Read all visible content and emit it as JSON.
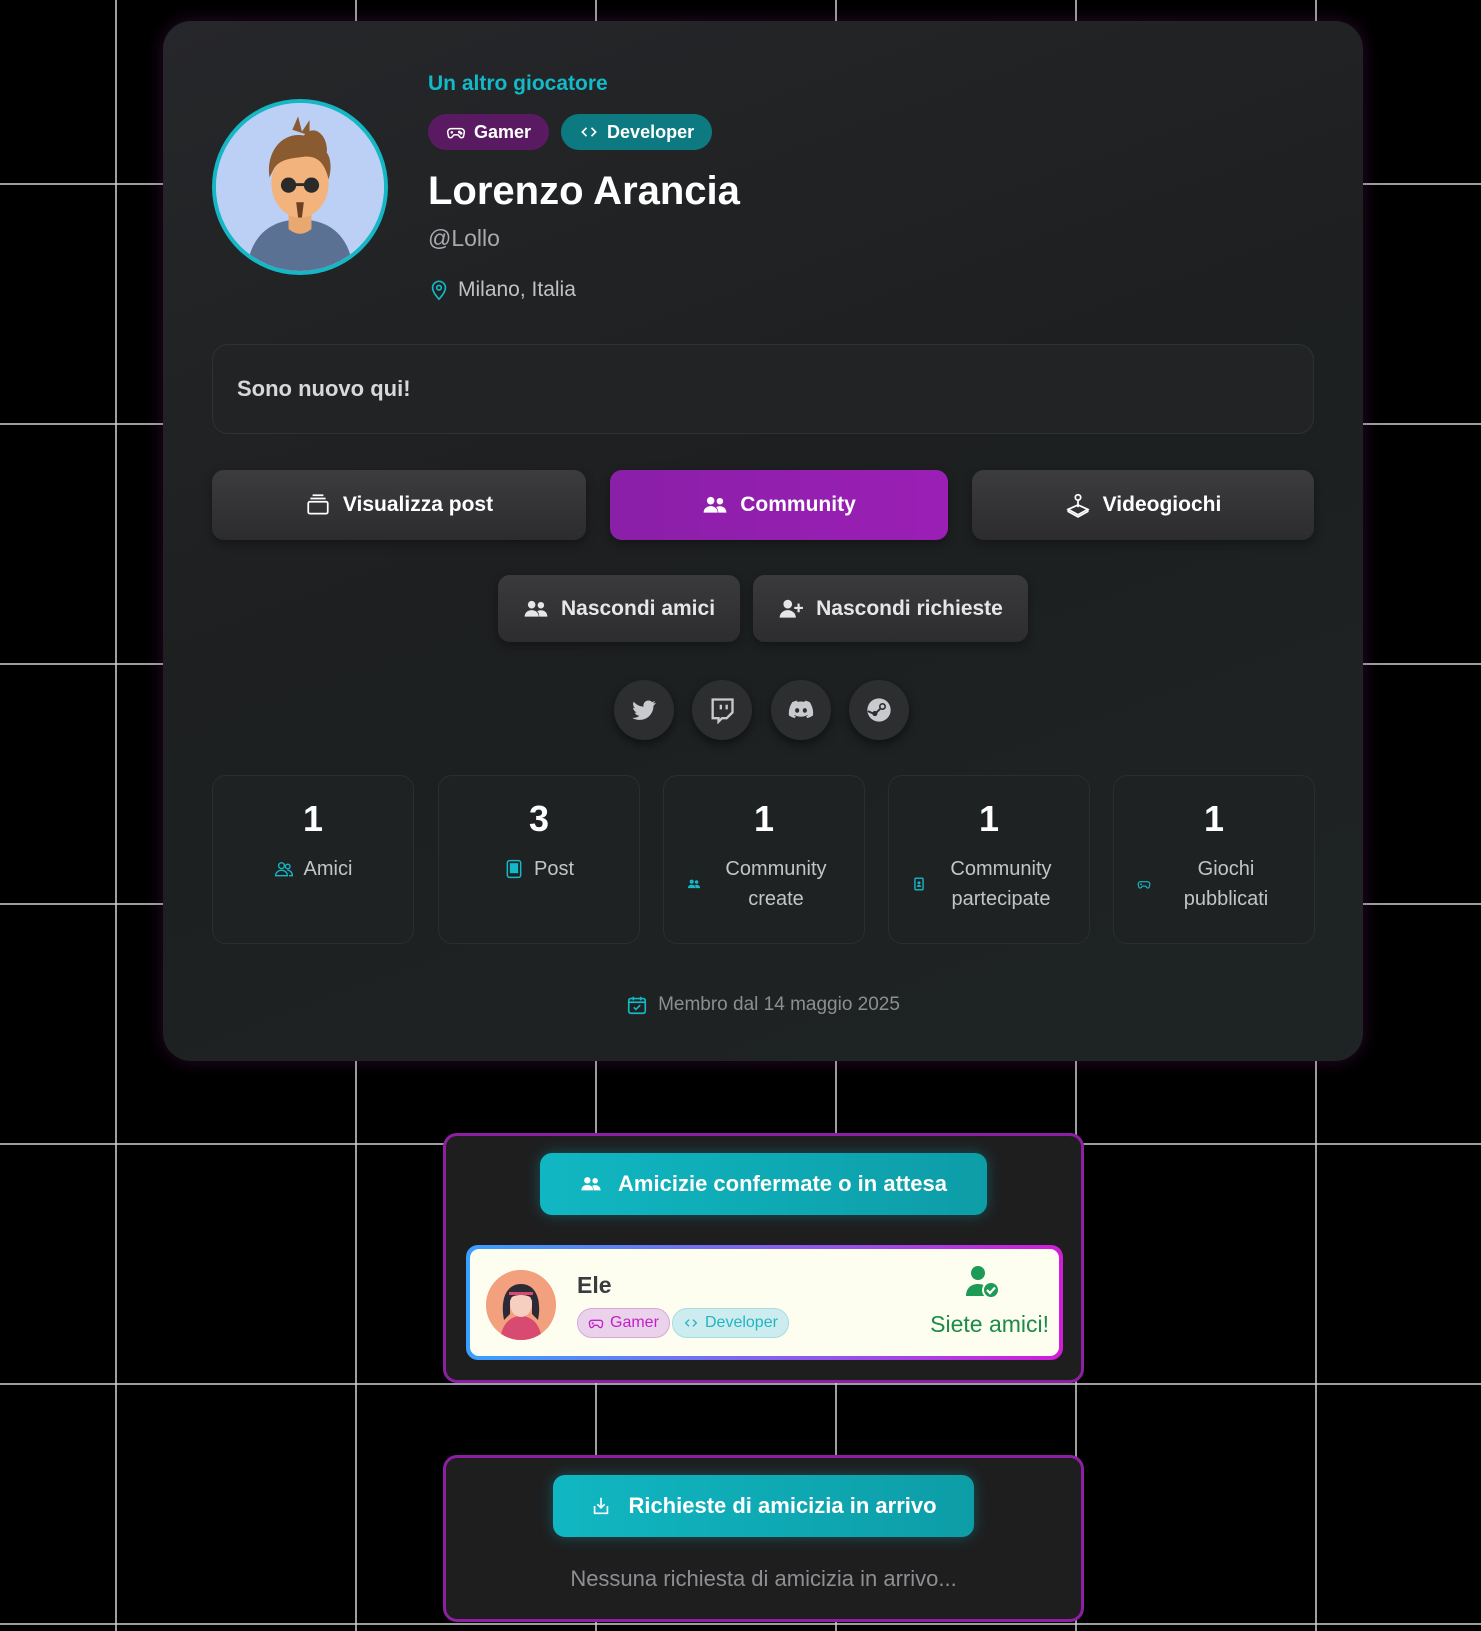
{
  "profile": {
    "subtitle": "Un altro giocatore",
    "badges": [
      {
        "label": "Gamer",
        "icon": "gamepad-icon",
        "color": "#5a1a62"
      },
      {
        "label": "Developer",
        "icon": "code-icon",
        "color": "#0c7a80"
      }
    ],
    "name": "Lorenzo Arancia",
    "handle": "@Lollo",
    "location": "Milano, Italia",
    "bio": "Sono nuovo qui!",
    "accent_color": "#13b9c6",
    "brand_purple": "#8a1fa8"
  },
  "nav": {
    "posts_label": "Visualizza post",
    "community_label": "Community",
    "games_label": "Videogiochi",
    "active": "Community"
  },
  "toggles": {
    "friends_label": "Nascondi amici",
    "requests_label": "Nascondi richieste"
  },
  "social_links": [
    {
      "icon": "twitter-icon"
    },
    {
      "icon": "twitch-icon"
    },
    {
      "icon": "discord-icon"
    },
    {
      "icon": "steam-icon"
    }
  ],
  "stats": [
    {
      "value": "1",
      "label": "Amici",
      "icon": "users-icon"
    },
    {
      "value": "3",
      "label": "Post",
      "icon": "post-icon"
    },
    {
      "value": "1",
      "label": "Community create",
      "icon": "group-icon"
    },
    {
      "value": "1",
      "label": "Community partecipate",
      "icon": "badge-icon"
    },
    {
      "value": "1",
      "label": "Giochi pubblicati",
      "icon": "gamepad-icon"
    }
  ],
  "member_since": "Membro dal 14 maggio 2025",
  "friends_panel": {
    "title": "Amicizie confermate o in attesa",
    "friends": [
      {
        "name": "Ele",
        "badges": [
          "Gamer",
          "Developer"
        ],
        "status": "Siete amici!",
        "status_color": "#1d8a4a"
      }
    ]
  },
  "requests_panel": {
    "title": "Richieste di amicizia in arrivo",
    "empty_text": "Nessuna richiesta di amicizia in arrivo..."
  }
}
